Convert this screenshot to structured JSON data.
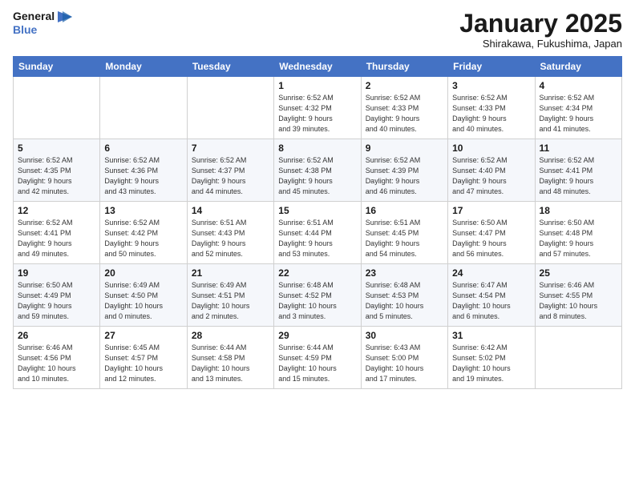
{
  "header": {
    "logo_line1": "General",
    "logo_line2": "Blue",
    "month": "January 2025",
    "location": "Shirakawa, Fukushima, Japan"
  },
  "days_of_week": [
    "Sunday",
    "Monday",
    "Tuesday",
    "Wednesday",
    "Thursday",
    "Friday",
    "Saturday"
  ],
  "weeks": [
    [
      {
        "day": "",
        "info": ""
      },
      {
        "day": "",
        "info": ""
      },
      {
        "day": "",
        "info": ""
      },
      {
        "day": "1",
        "info": "Sunrise: 6:52 AM\nSunset: 4:32 PM\nDaylight: 9 hours\nand 39 minutes."
      },
      {
        "day": "2",
        "info": "Sunrise: 6:52 AM\nSunset: 4:33 PM\nDaylight: 9 hours\nand 40 minutes."
      },
      {
        "day": "3",
        "info": "Sunrise: 6:52 AM\nSunset: 4:33 PM\nDaylight: 9 hours\nand 40 minutes."
      },
      {
        "day": "4",
        "info": "Sunrise: 6:52 AM\nSunset: 4:34 PM\nDaylight: 9 hours\nand 41 minutes."
      }
    ],
    [
      {
        "day": "5",
        "info": "Sunrise: 6:52 AM\nSunset: 4:35 PM\nDaylight: 9 hours\nand 42 minutes."
      },
      {
        "day": "6",
        "info": "Sunrise: 6:52 AM\nSunset: 4:36 PM\nDaylight: 9 hours\nand 43 minutes."
      },
      {
        "day": "7",
        "info": "Sunrise: 6:52 AM\nSunset: 4:37 PM\nDaylight: 9 hours\nand 44 minutes."
      },
      {
        "day": "8",
        "info": "Sunrise: 6:52 AM\nSunset: 4:38 PM\nDaylight: 9 hours\nand 45 minutes."
      },
      {
        "day": "9",
        "info": "Sunrise: 6:52 AM\nSunset: 4:39 PM\nDaylight: 9 hours\nand 46 minutes."
      },
      {
        "day": "10",
        "info": "Sunrise: 6:52 AM\nSunset: 4:40 PM\nDaylight: 9 hours\nand 47 minutes."
      },
      {
        "day": "11",
        "info": "Sunrise: 6:52 AM\nSunset: 4:41 PM\nDaylight: 9 hours\nand 48 minutes."
      }
    ],
    [
      {
        "day": "12",
        "info": "Sunrise: 6:52 AM\nSunset: 4:41 PM\nDaylight: 9 hours\nand 49 minutes."
      },
      {
        "day": "13",
        "info": "Sunrise: 6:52 AM\nSunset: 4:42 PM\nDaylight: 9 hours\nand 50 minutes."
      },
      {
        "day": "14",
        "info": "Sunrise: 6:51 AM\nSunset: 4:43 PM\nDaylight: 9 hours\nand 52 minutes."
      },
      {
        "day": "15",
        "info": "Sunrise: 6:51 AM\nSunset: 4:44 PM\nDaylight: 9 hours\nand 53 minutes."
      },
      {
        "day": "16",
        "info": "Sunrise: 6:51 AM\nSunset: 4:45 PM\nDaylight: 9 hours\nand 54 minutes."
      },
      {
        "day": "17",
        "info": "Sunrise: 6:50 AM\nSunset: 4:47 PM\nDaylight: 9 hours\nand 56 minutes."
      },
      {
        "day": "18",
        "info": "Sunrise: 6:50 AM\nSunset: 4:48 PM\nDaylight: 9 hours\nand 57 minutes."
      }
    ],
    [
      {
        "day": "19",
        "info": "Sunrise: 6:50 AM\nSunset: 4:49 PM\nDaylight: 9 hours\nand 59 minutes."
      },
      {
        "day": "20",
        "info": "Sunrise: 6:49 AM\nSunset: 4:50 PM\nDaylight: 10 hours\nand 0 minutes."
      },
      {
        "day": "21",
        "info": "Sunrise: 6:49 AM\nSunset: 4:51 PM\nDaylight: 10 hours\nand 2 minutes."
      },
      {
        "day": "22",
        "info": "Sunrise: 6:48 AM\nSunset: 4:52 PM\nDaylight: 10 hours\nand 3 minutes."
      },
      {
        "day": "23",
        "info": "Sunrise: 6:48 AM\nSunset: 4:53 PM\nDaylight: 10 hours\nand 5 minutes."
      },
      {
        "day": "24",
        "info": "Sunrise: 6:47 AM\nSunset: 4:54 PM\nDaylight: 10 hours\nand 6 minutes."
      },
      {
        "day": "25",
        "info": "Sunrise: 6:46 AM\nSunset: 4:55 PM\nDaylight: 10 hours\nand 8 minutes."
      }
    ],
    [
      {
        "day": "26",
        "info": "Sunrise: 6:46 AM\nSunset: 4:56 PM\nDaylight: 10 hours\nand 10 minutes."
      },
      {
        "day": "27",
        "info": "Sunrise: 6:45 AM\nSunset: 4:57 PM\nDaylight: 10 hours\nand 12 minutes."
      },
      {
        "day": "28",
        "info": "Sunrise: 6:44 AM\nSunset: 4:58 PM\nDaylight: 10 hours\nand 13 minutes."
      },
      {
        "day": "29",
        "info": "Sunrise: 6:44 AM\nSunset: 4:59 PM\nDaylight: 10 hours\nand 15 minutes."
      },
      {
        "day": "30",
        "info": "Sunrise: 6:43 AM\nSunset: 5:00 PM\nDaylight: 10 hours\nand 17 minutes."
      },
      {
        "day": "31",
        "info": "Sunrise: 6:42 AM\nSunset: 5:02 PM\nDaylight: 10 hours\nand 19 minutes."
      },
      {
        "day": "",
        "info": ""
      }
    ]
  ]
}
